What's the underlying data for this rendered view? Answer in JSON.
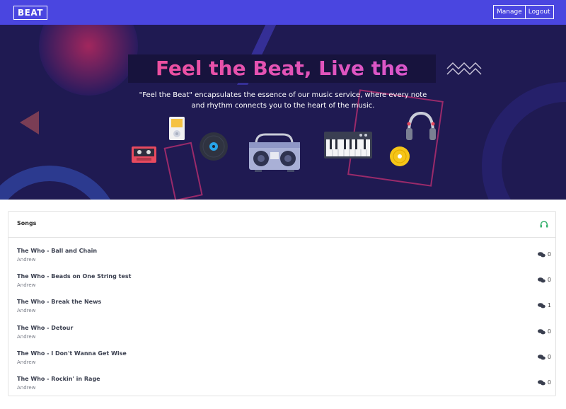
{
  "nav": {
    "logo": "BEAT",
    "manage_label": "Manage",
    "logout_label": "Logout",
    "color": "#4a46e0"
  },
  "hero": {
    "title": "Feel the Beat, Live the Music!",
    "subtitle": "\"Feel the Beat\" encapsulates the essence of our music service, where every note and rhythm connects you to the heart of the music.",
    "background": "#1f1a52",
    "icons": [
      "cassette-icon",
      "mp3-player-icon",
      "vinyl-record-icon",
      "boombox-icon",
      "keyboard-icon",
      "cd-icon",
      "headphones-icon"
    ]
  },
  "songs_card": {
    "title": "Songs",
    "header_icon": "headphones-icon",
    "items": [
      {
        "title": "The Who - Ball and Chain",
        "artist": "Andrew",
        "comments": "0"
      },
      {
        "title": "The Who - Beads on One String test",
        "artist": "Andrew",
        "comments": "0"
      },
      {
        "title": "The Who - Break the News",
        "artist": "Andrew",
        "comments": "1"
      },
      {
        "title": "The Who - Detour",
        "artist": "Andrew",
        "comments": "0"
      },
      {
        "title": "The Who - I Don't Wanna Get Wise",
        "artist": "Andrew",
        "comments": "0"
      },
      {
        "title": "The Who - Rockin' in Rage",
        "artist": "Andrew",
        "comments": "0"
      }
    ]
  }
}
